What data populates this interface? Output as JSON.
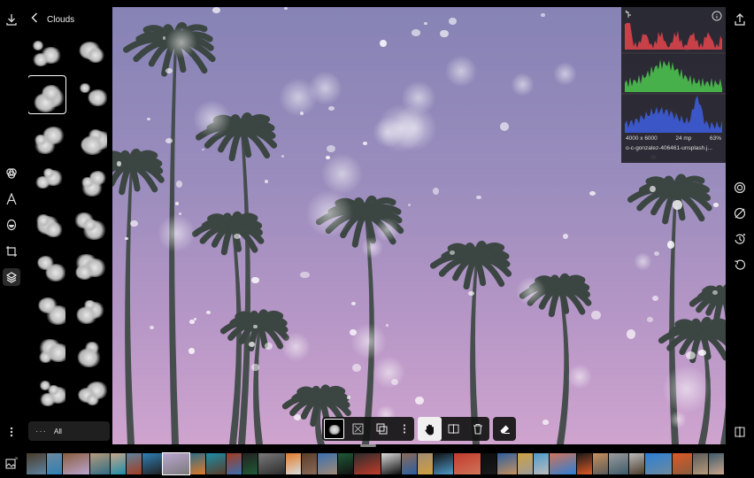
{
  "panel": {
    "title": "Clouds",
    "footer_dots": "···",
    "footer_label": "All",
    "thumb_count": 20,
    "selected_index": 2
  },
  "histogram": {
    "dimensions": "4000 x 6000",
    "megapixels": "24 mp",
    "zoom": "63%",
    "filename": "o-c-gonzalez-406461-unsplash.j...",
    "colors": {
      "red": "#d9434a",
      "green": "#4bbf4e",
      "blue": "#3d5bd6"
    }
  },
  "left_rail": {
    "icons": [
      "download-icon",
      "filters-icon",
      "text-icon",
      "mask-icon",
      "crop-icon",
      "layers-icon",
      "more-icon"
    ]
  },
  "right_rail": {
    "icons": [
      "share-icon",
      "details-icon",
      "effect-icon",
      "undo-icon",
      "revert-icon",
      "compare-icon"
    ]
  },
  "toolbar": {
    "left_group": [
      "layer-thumbnail",
      "fit-icon",
      "duplicate-icon",
      "more-icon"
    ],
    "mid_group": [
      "hand-icon",
      "split-icon",
      "trash-icon"
    ],
    "right_group": [
      "eraser-icon"
    ]
  },
  "filmstrip": {
    "colors": [
      "#4a3a2a",
      "#6e8a9e",
      "#8a5c3c",
      "#b79a7c",
      "#caa58a",
      "#5d84a0",
      "#2f7fb5",
      "#bba6d1",
      "#2e6d86",
      "#1b8da8",
      "#a33b20",
      "#222",
      "#7a7a7a",
      "#e07a2a",
      "#5a3d28",
      "#3a6fb0",
      "#1f5a36",
      "#2b2b2b",
      "#dcdcdc",
      "#8a6a5a",
      "#a18a74",
      "#111",
      "#c23b2b",
      "#0c0c0c",
      "#2c5fa0",
      "#d0a040",
      "#4d9acb",
      "#d0745a",
      "#1a1a1a",
      "#c8905c",
      "#9c9c9c",
      "#bcbcbc",
      "#2b7fd6",
      "#dc5a28",
      "#5a5a5a",
      "#3d5a6a"
    ],
    "selected_index": 7
  },
  "accent": "#ffffff"
}
